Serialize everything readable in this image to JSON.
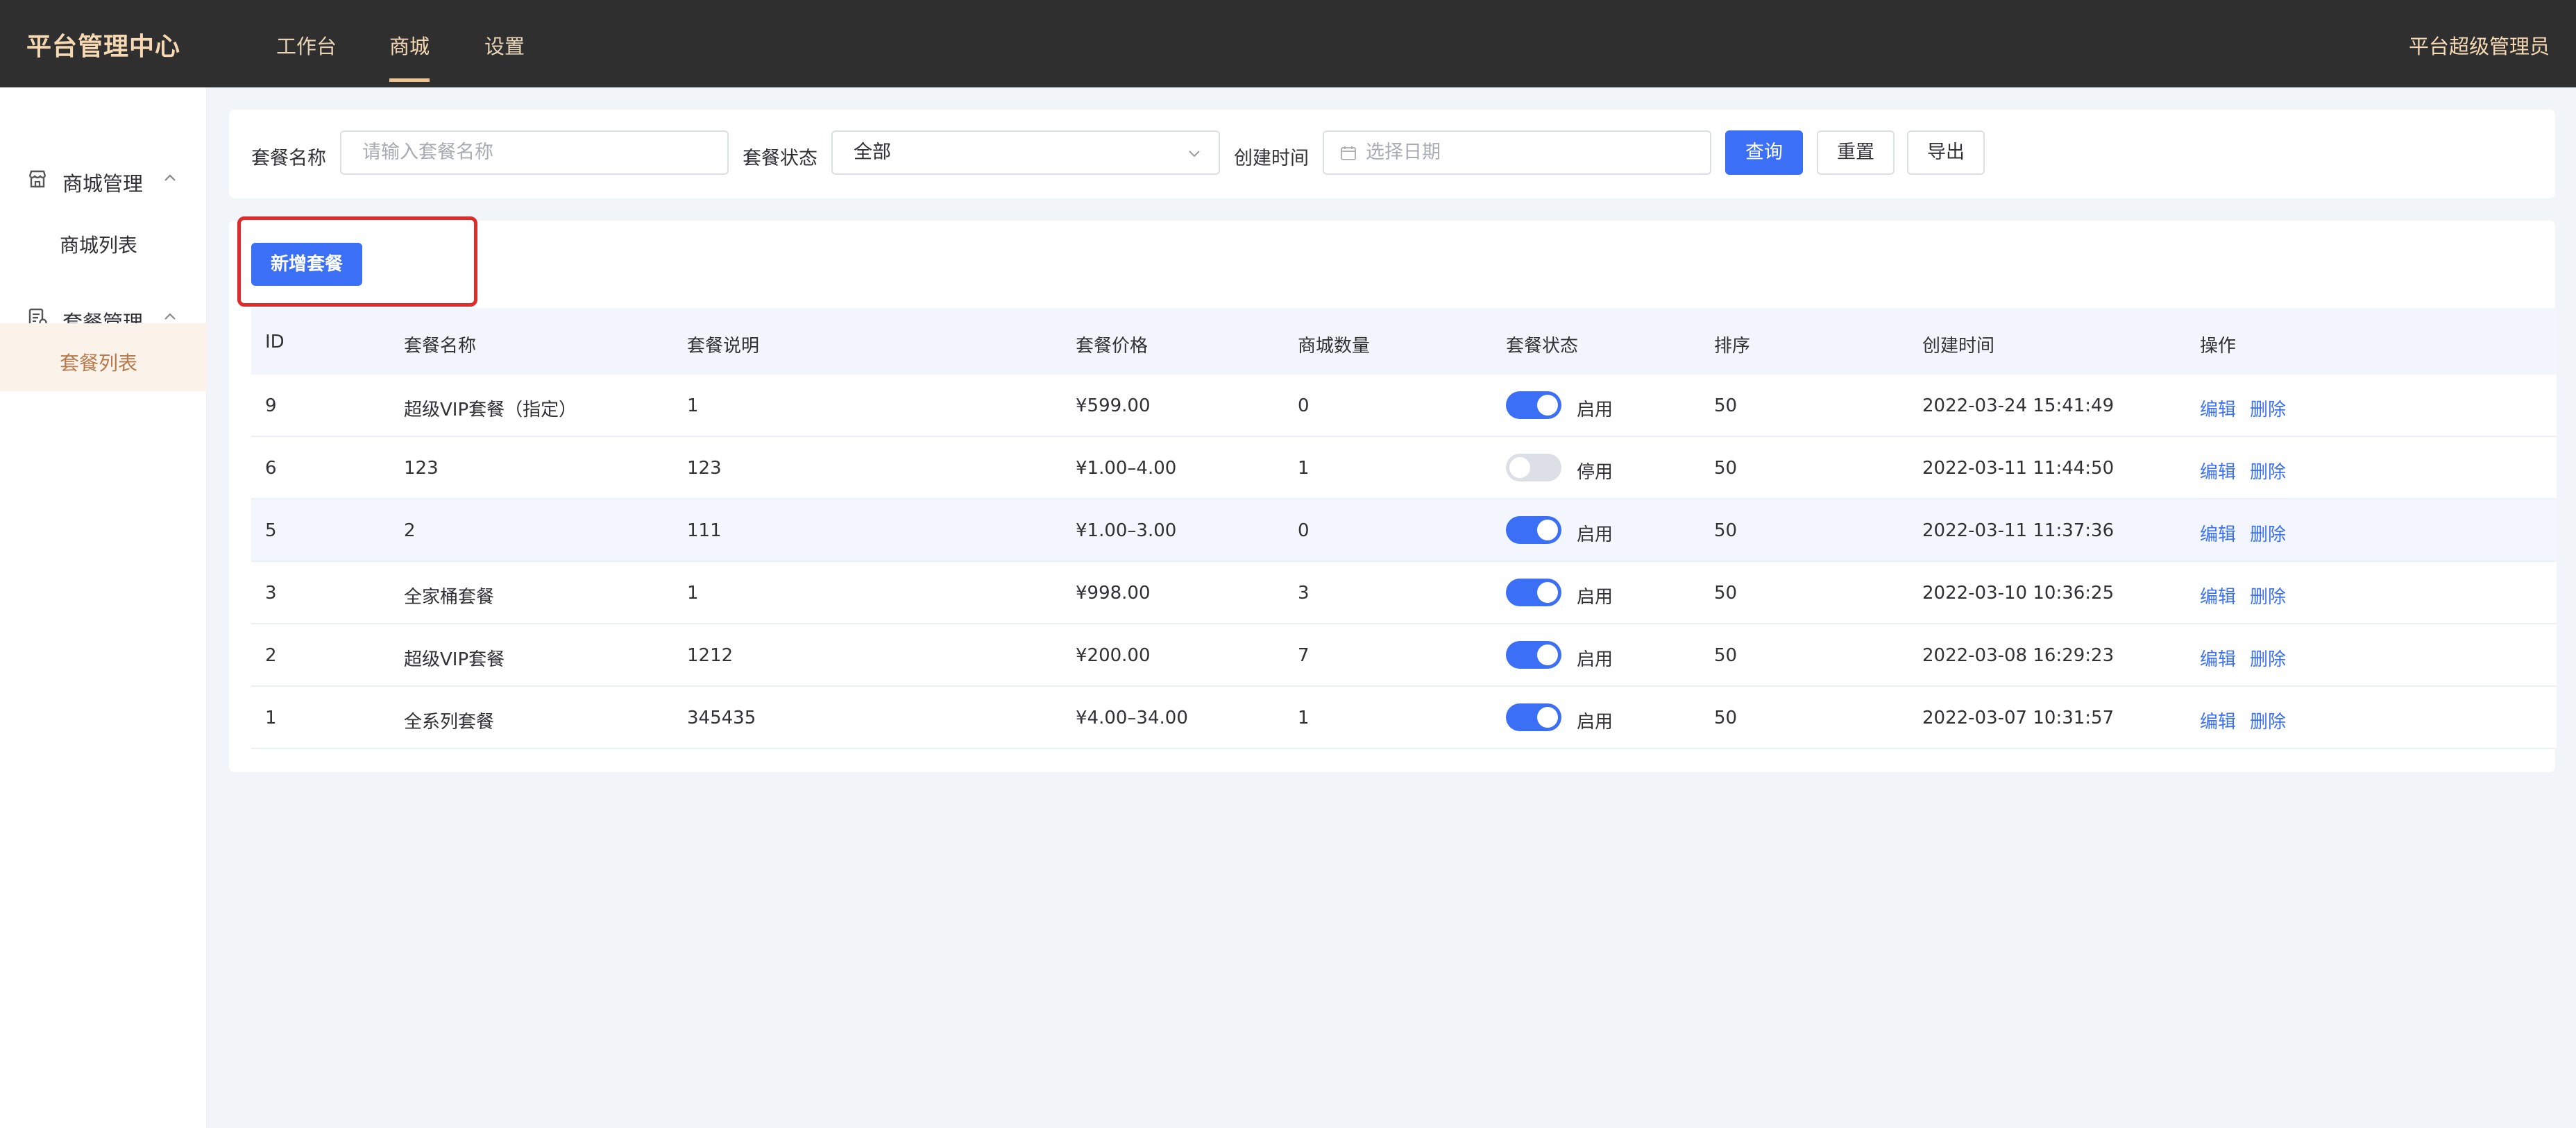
{
  "header": {
    "brand": "平台管理中心",
    "nav": [
      "工作台",
      "商城",
      "设置"
    ],
    "active_nav": "商城",
    "user": "平台超级管理员"
  },
  "sidebar": {
    "groups": [
      {
        "label": "商城管理",
        "icon": "store-icon",
        "items": [
          "商城列表"
        ]
      },
      {
        "label": "套餐管理",
        "icon": "package-list-icon",
        "items": [
          "套餐列表"
        ]
      }
    ],
    "active_item": "套餐列表"
  },
  "filters": {
    "name_label": "套餐名称",
    "name_placeholder": "请输入套餐名称",
    "status_label": "套餐状态",
    "status_value": "全部",
    "date_label": "创建时间",
    "date_placeholder": "选择日期",
    "query_label": "查询",
    "reset_label": "重置",
    "export_label": "导出"
  },
  "toolbar": {
    "add_label": "新增套餐"
  },
  "table": {
    "columns": [
      "ID",
      "套餐名称",
      "套餐说明",
      "套餐价格",
      "商城数量",
      "套餐状态",
      "排序",
      "创建时间",
      "操作"
    ],
    "rows": [
      {
        "id": "9",
        "name": "超级VIP套餐（指定）",
        "desc": "1",
        "price": "¥599.00",
        "count": "0",
        "enabled": true,
        "status": "启用",
        "sort": "50",
        "created": "2022-03-24 15:41:49"
      },
      {
        "id": "6",
        "name": "123",
        "desc": "123",
        "price": "¥1.00–4.00",
        "count": "1",
        "enabled": false,
        "status": "停用",
        "sort": "50",
        "created": "2022-03-11 11:44:50"
      },
      {
        "id": "5",
        "name": "2",
        "desc": "111",
        "price": "¥1.00–3.00",
        "count": "0",
        "enabled": true,
        "status": "启用",
        "sort": "50",
        "created": "2022-03-11 11:37:36"
      },
      {
        "id": "3",
        "name": "全家桶套餐",
        "desc": "1",
        "price": "¥998.00",
        "count": "3",
        "enabled": true,
        "status": "启用",
        "sort": "50",
        "created": "2022-03-10 10:36:25"
      },
      {
        "id": "2",
        "name": "超级VIP套餐",
        "desc": "1212",
        "price": "¥200.00",
        "count": "7",
        "enabled": true,
        "status": "启用",
        "sort": "50",
        "created": "2022-03-08 16:29:23"
      },
      {
        "id": "1",
        "name": "全系列套餐",
        "desc": "345435",
        "price": "¥4.00–34.00",
        "count": "1",
        "enabled": true,
        "status": "启用",
        "sort": "50",
        "created": "2022-03-07 10:31:57"
      }
    ],
    "edit_label": "编辑",
    "delete_label": "删除"
  },
  "colors": {
    "header_bg": "#2f2f2f",
    "brand_text": "#f6d9b3",
    "primary": "#3b6ff5",
    "highlight": "#e02b2b",
    "active_item_text": "#b7784c"
  }
}
